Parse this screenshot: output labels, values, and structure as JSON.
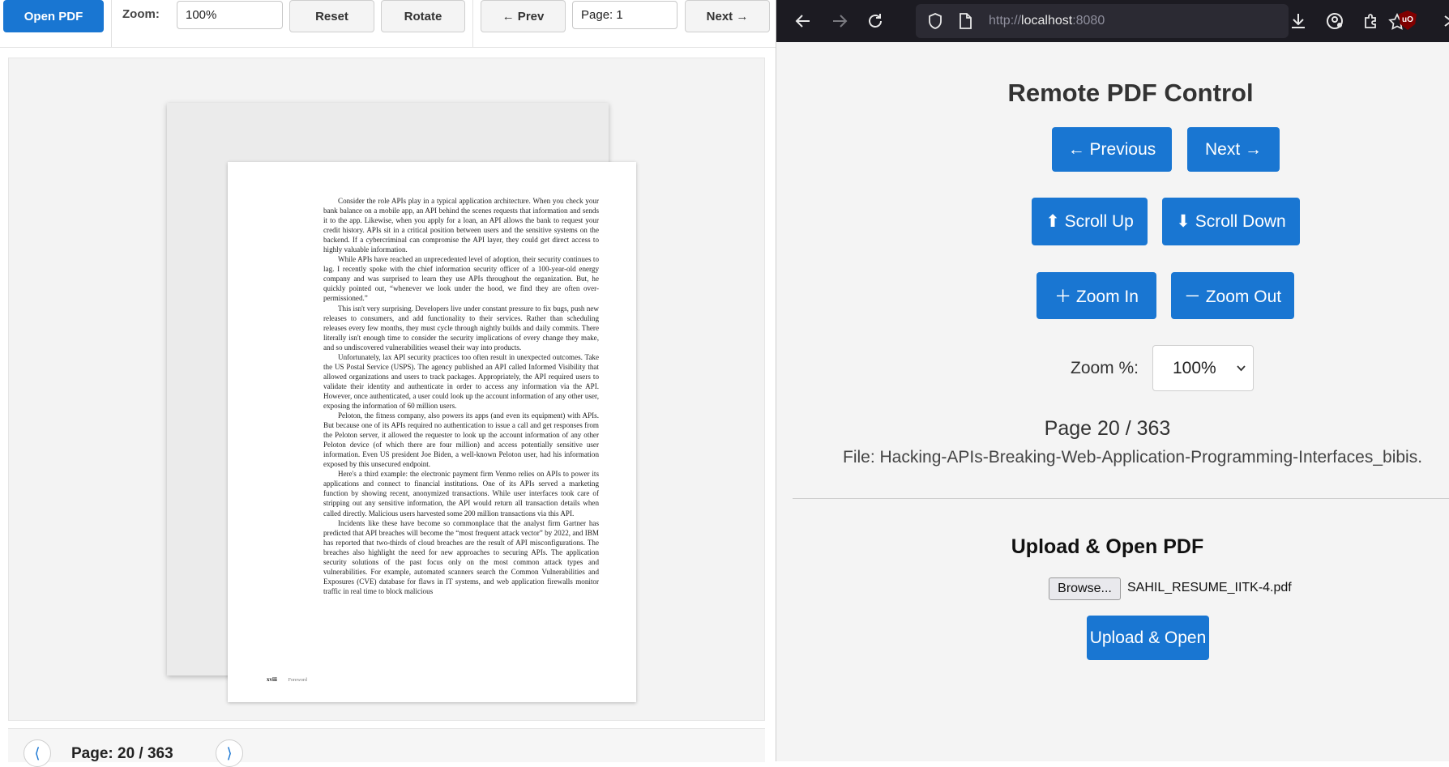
{
  "viewer": {
    "toolbar": {
      "open_pdf": "Open PDF",
      "zoom_label": "Zoom:",
      "zoom_value": "100%",
      "reset": "Reset",
      "rotate": "Rotate",
      "prev": "← Prev",
      "page_value": "Page: 1",
      "next": "Next →"
    },
    "document": {
      "paragraphs": [
        "Consider the role APIs play in a typical application architecture. When you check your bank balance on a mobile app, an API behind the scenes requests that information and sends it to the app. Likewise, when you apply for a loan, an API allows the bank to request your credit history. APIs sit in a critical position between users and the sensitive systems on the backend. If a cybercriminal can compromise the API layer, they could get direct access to highly valuable information.",
        "While APIs have reached an unprecedented level of adoption, their security continues to lag. I recently spoke with the chief information security officer of a 100-year-old energy company and was surprised to learn they use APIs throughout the organization. But, he quickly pointed out, “whenever we look under the hood, we find they are often over-permissioned.”",
        "This isn't very surprising. Developers live under constant pressure to fix bugs, push new releases to consumers, and add functionality to their services. Rather than scheduling releases every few months, they must cycle through nightly builds and daily commits. There literally isn't enough time to consider the security implications of every change they make, and so undiscovered vulnerabilities weasel their way into products.",
        "Unfortunately, lax API security practices too often result in unexpected outcomes. Take the US Postal Service (USPS). The agency published an API called Informed Visibility that allowed organizations and users to track packages. Appropriately, the API required users to validate their identity and authenticate in order to access any information via the API. However, once authenticated, a user could look up the account information of any other user, exposing the information of 60 million users.",
        "Peloton, the fitness company, also powers its apps (and even its equipment) with APIs. But because one of its APIs required no authentication to issue a call and get responses from the Peloton server, it allowed the requester to look up the account information of any other Peloton device (of which there are four million) and access potentially sensitive user information. Even US president Joe Biden, a well-known Peloton user, had his information exposed by this unsecured endpoint.",
        "Here's a third example: the electronic payment firm Venmo relies on APIs to power its applications and connect to financial institutions. One of its APIs served a marketing function by showing recent, anonymized transactions. While user interfaces took care of stripping out any sensitive information, the API would return all transaction details when called directly. Malicious users harvested some 200 million transactions via this API.",
        "Incidents like these have become so commonplace that the analyst firm Gartner has predicted that API breaches will become the “most frequent attack vector” by 2022, and IBM has reported that two-thirds of cloud breaches are the result of API misconfigurations. The breaches also highlight the need for new approaches to securing APIs. The application security solutions of the past focus only on the most common attack types and vulnerabilities. For example, automated scanners search the Common Vulnerabilities and Exposures (CVE) database for flaws in IT systems, and web application firewalls monitor traffic in real time to block malicious"
      ],
      "footer_page": "xviii",
      "footer_label": "Foreword"
    },
    "bottom": {
      "prev_glyph": "⟨",
      "next_glyph": "⟩",
      "page_label": "Page: 20 / 363"
    }
  },
  "browser": {
    "url_scheme": "http://",
    "url_host": "localhost",
    "url_port": ":8080",
    "ublock_badge": "uO"
  },
  "remote": {
    "title": "Remote PDF Control",
    "prev": "← Previous",
    "next": "Next →",
    "scroll_up": "⬆ Scroll Up",
    "scroll_down": "⬇ Scroll Down",
    "zoom_in": "＋ Zoom In",
    "zoom_out": "－ Zoom Out",
    "zoom_label": "Zoom %:",
    "zoom_value": "100%",
    "page_status": "Page 20 / 363",
    "file_name": "File: Hacking-APIs-Breaking-Web-Application-Programming-Interfaces_bibis.",
    "upload_title": "Upload & Open PDF",
    "browse": "Browse...",
    "chosen_file": "SAHIL_RESUME_IITK-4.pdf",
    "upload_open": "Upload & Open"
  },
  "colors": {
    "accent": "#1976d2",
    "browser_chrome": "#1c1b22",
    "page_bg": "#f4f4f4"
  }
}
